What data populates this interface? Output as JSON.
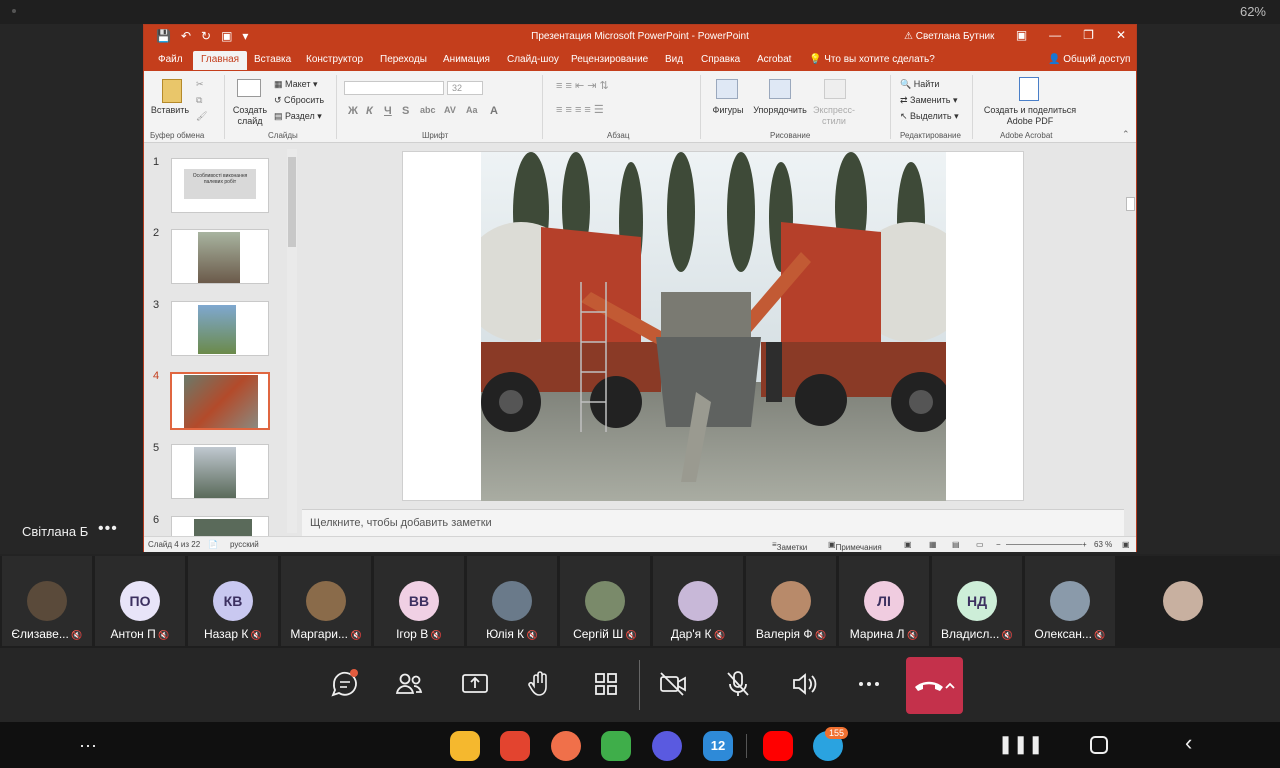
{
  "status_bar": {
    "battery": "62%"
  },
  "presenter": {
    "name": "Світлана Б",
    "more": "•••"
  },
  "ppt": {
    "window_title": "Презентация Microsoft PowerPoint - PowerPoint",
    "user": "Светлана Бутник",
    "tabs": [
      "Файл",
      "Главная",
      "Вставка",
      "Конструктор",
      "Переходы",
      "Анимация",
      "Слайд-шоу",
      "Рецензирование",
      "Вид",
      "Справка",
      "Acrobat"
    ],
    "active_tab": "Главная",
    "tell_me": "Что вы хотите сделать?",
    "share": "Общий доступ",
    "ribbon": {
      "paste": "Вставить",
      "clipboard_group": "Буфер обмена",
      "new_slide": "Создать слайд",
      "layout": "Макет",
      "reset": "Сбросить",
      "section": "Раздел",
      "slides_group": "Слайды",
      "font_size": "32",
      "font_group": "Шрифт",
      "paragraph_group": "Абзац",
      "shapes": "Фигуры",
      "arrange": "Упорядочить",
      "quick_styles": "Экспресс-стили",
      "drawing_group": "Рисование",
      "find": "Найти",
      "replace": "Заменить",
      "select": "Выделить",
      "editing_group": "Редактирование",
      "create_share_pdf": "Создать и поделиться Adobe PDF",
      "acrobat_group": "Adobe Acrobat"
    },
    "thumbnails": [
      "1",
      "2",
      "3",
      "4",
      "5",
      "6"
    ],
    "slide1_text": "Особливості виконання палевих робіт",
    "active_slide": 4,
    "notes_placeholder": "Щелкните, чтобы добавить заметки",
    "status": {
      "slide_info": "Слайд 4 из 22",
      "language": "русский",
      "notes": "Заметки",
      "comments": "Примечания",
      "zoom": "63 %"
    }
  },
  "participants": [
    {
      "name": "Єлизаве...",
      "initials": "",
      "color": "#5a4a3a"
    },
    {
      "name": "Антон П",
      "initials": "ПО",
      "color": "#e8e4f8"
    },
    {
      "name": "Назар К",
      "initials": "КВ",
      "color": "#c9c8f0"
    },
    {
      "name": "Маргари...",
      "initials": "",
      "color": "#8a6b4a"
    },
    {
      "name": "Ігор В",
      "initials": "ВВ",
      "color": "#f0d0e4"
    },
    {
      "name": "Юлія К",
      "initials": "",
      "color": "#6a7a8a"
    },
    {
      "name": "Сергій Ш",
      "initials": "",
      "color": "#7a8a6a"
    },
    {
      "name": "Дар'я К",
      "initials": "",
      "color": "#c8b8d8"
    },
    {
      "name": "Валерія Ф",
      "initials": "",
      "color": "#b88a6a"
    },
    {
      "name": "Марина Л",
      "initials": "ЛІ",
      "color": "#f0cce0"
    },
    {
      "name": "Владисл...",
      "initials": "НД",
      "color": "#cdeed8"
    },
    {
      "name": "Олексан...",
      "initials": "",
      "color": "#8a9aaa"
    }
  ],
  "telegram_badge": "155",
  "calendar_day": "12"
}
